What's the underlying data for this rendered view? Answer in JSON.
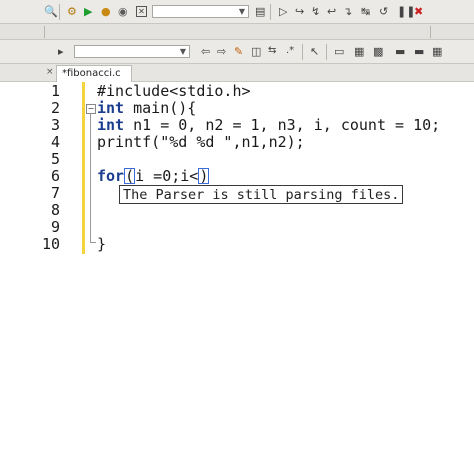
{
  "toolbar": {
    "row1_icons": [
      "search-icon",
      "settings-icon",
      "run-icon",
      "debug-icon",
      "stop-icon",
      "close-icon"
    ],
    "row1_right_icons": [
      "run-to-cursor-icon",
      "step-over-icon",
      "step-into-icon",
      "step-out-icon",
      "next-instruction-icon",
      "step-into-instruction-icon",
      "pause-icon",
      "stop-debug-icon"
    ],
    "row3_icons": [
      "bookmark-icon"
    ],
    "row3_right_icons": [
      "back-icon",
      "forward-icon",
      "highlight-icon",
      "replace-icon",
      "regex-icon",
      "select-icon",
      "view-icon",
      "window-icon",
      "panel-icon",
      "layout-icon"
    ]
  },
  "tabs": [
    {
      "label": "*fibonacci.c",
      "close": "×"
    }
  ],
  "editor": {
    "line_numbers": [
      "1",
      "2",
      "3",
      "4",
      "5",
      "6",
      "7",
      "8",
      "9",
      "10"
    ],
    "lines": {
      "l1": "#include<stdio.h>",
      "l2_kw": "int",
      "l2_rest": " main(){",
      "l3_kw": "int",
      "l3_rest": " n1 = 0, n2 = 1, n3, i, count = 10;",
      "l4": "printf(\"%d %d \",n1,n2);",
      "l6_kw": "for",
      "l6_rest": "i =0;i<",
      "l6_open": "(",
      "l6_close": ")",
      "l10": "}"
    },
    "tooltip": "The Parser is still parsing files."
  }
}
